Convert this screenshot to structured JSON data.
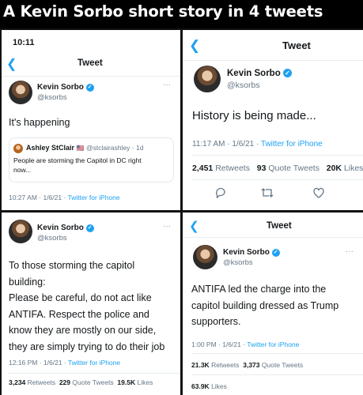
{
  "banner": {
    "title": "A Kevin Sorbo short story in 4 tweets"
  },
  "author": {
    "name": "Kevin Sorbo",
    "handle": "@ksorbs"
  },
  "panel1": {
    "status_time": "10:11",
    "header_title": "Tweet",
    "more": "···",
    "text": "It's happening",
    "quoted": {
      "name": "Ashley StClair",
      "flag": "🇺🇸",
      "handle": "@stclairashley · 1d",
      "text_line1": "People are storming the Capitol in DC right",
      "text_line2": "now..."
    },
    "meta_time": "10:27 AM · 1/6/21 · ",
    "meta_source": "Twitter for iPhone"
  },
  "panel2": {
    "header_title": "Tweet",
    "text": "History is being made...",
    "meta_time": "11:17 AM · 1/6/21 · ",
    "meta_source": "Twitter for iPhone",
    "retweets_num": "2,451",
    "retweets_lbl": "Retweets",
    "quotes_num": "93",
    "quotes_lbl": "Quote Tweets",
    "likes_num": "20K",
    "likes_lbl": "Likes"
  },
  "panel3": {
    "more": "···",
    "lines": [
      "To those storming the capitol",
      "building:",
      "Please be careful, do not act like",
      "ANTIFA. Respect the police and",
      "know they are mostly on our side,",
      "they are simply trying to do their job"
    ],
    "meta_time": "12:16 PM · 1/6/21 · ",
    "meta_source": "Twitter for iPhone",
    "retweets_num": "3,234",
    "retweets_lbl": "Retweets",
    "quotes_num": "229",
    "quotes_lbl": "Quote Tweets",
    "likes_num": "19.5K",
    "likes_lbl": "Likes"
  },
  "panel4": {
    "header_title": "Tweet",
    "more": "···",
    "lines": [
      "ANTIFA led the charge into the",
      "capitol building dressed as Trump",
      "supporters."
    ],
    "meta_time": "1:00 PM · 1/6/21 · ",
    "meta_source": "Twitter for iPhone",
    "retweets_num": "21.3K",
    "retweets_lbl": "Retweets",
    "quotes_num": "3,373",
    "quotes_lbl": "Quote Tweets",
    "likes_num": "63.9K",
    "likes_lbl": "Likes"
  },
  "icons": {
    "back": "chevron-left-icon",
    "reply": "comment-icon",
    "retweet": "retweet-icon",
    "like": "heart-icon",
    "verified": "verified-badge-icon"
  },
  "colors": {
    "accent": "#1da1f2",
    "text": "#14171a",
    "muted": "#657786",
    "banner_bg": "#000000"
  }
}
